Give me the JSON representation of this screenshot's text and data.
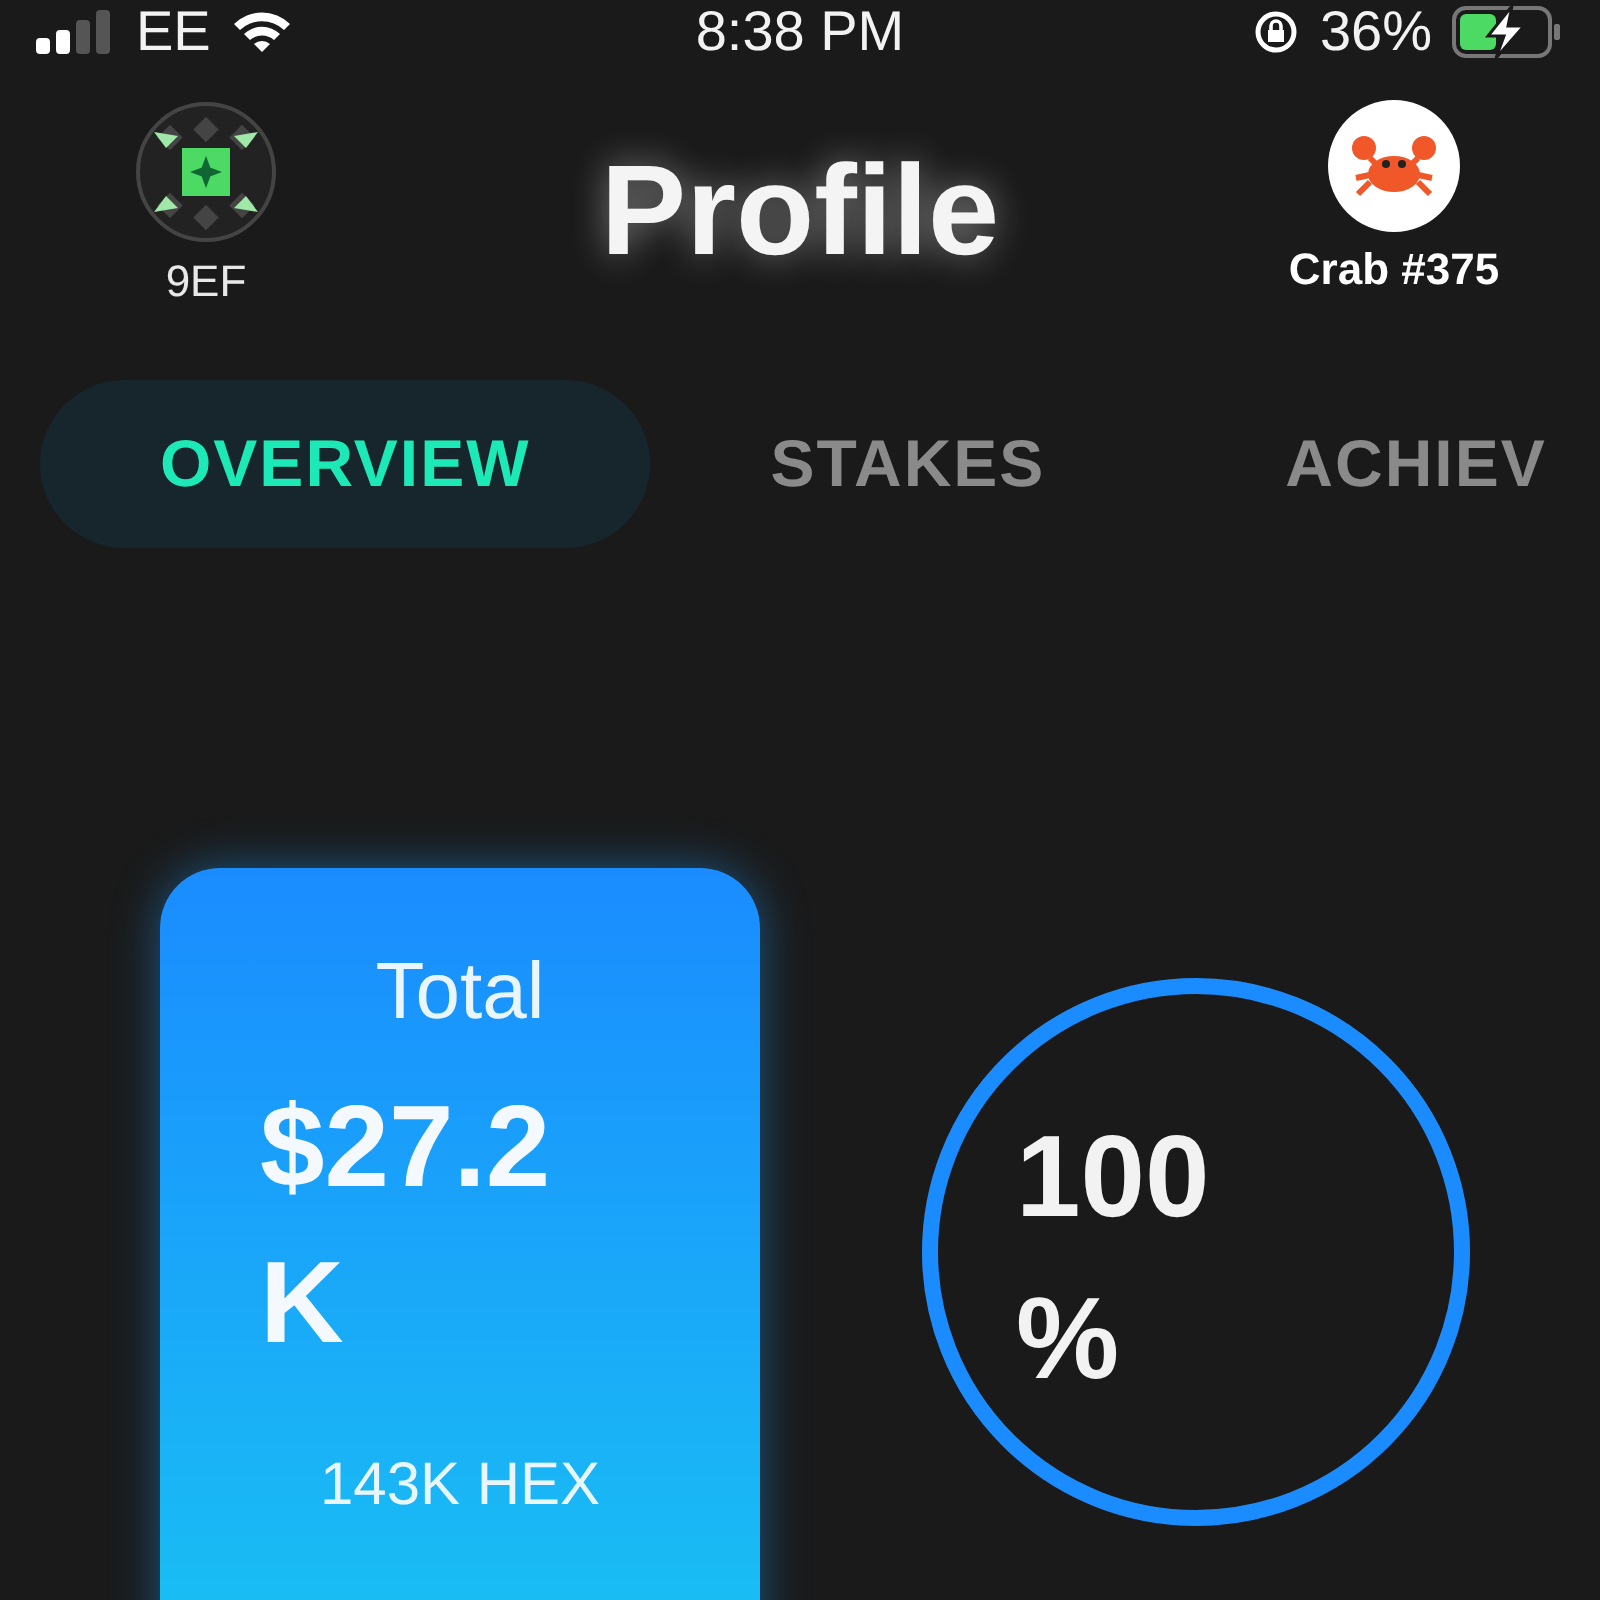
{
  "status_bar": {
    "carrier": "EE",
    "time": "8:38 PM",
    "battery": "36%"
  },
  "header": {
    "wallet": "9EF",
    "title": "Profile",
    "avatar_name": "Crab #375"
  },
  "tabs": [
    {
      "label": "OVERVIEW",
      "selected": true
    },
    {
      "label": "STAKES",
      "selected": false
    },
    {
      "label": "ACHIEV",
      "selected": false
    }
  ],
  "total_card": {
    "label": "Total",
    "value": "$27.2 K",
    "amount": "143K HEX"
  },
  "progress_ring": {
    "value": "100 %",
    "level": 1
  }
}
